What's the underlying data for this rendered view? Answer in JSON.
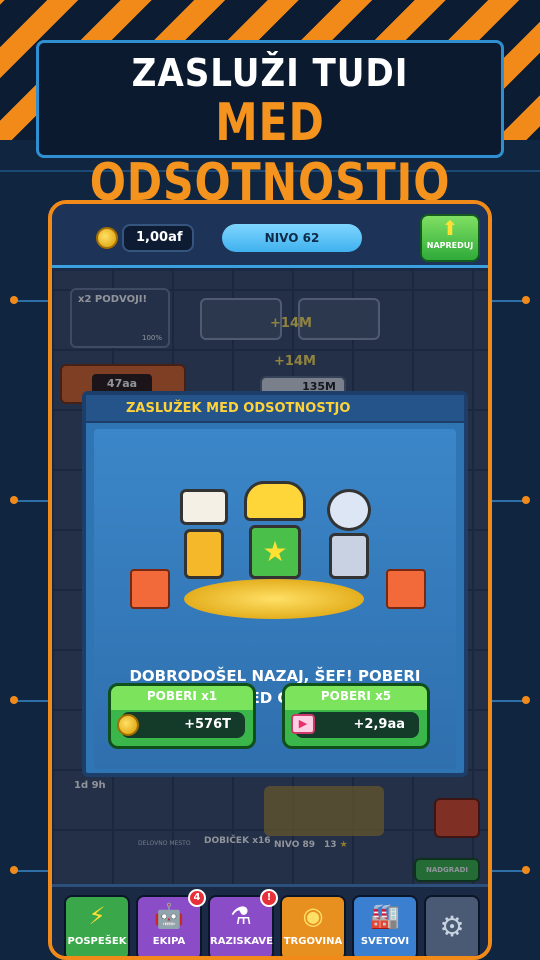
{
  "headline": {
    "line1": "ZASLUŽI TUDI",
    "line2": "MED ODSOTNOSTJO"
  },
  "topbar": {
    "money": "1,00af",
    "level": "NIVO 62",
    "advance_label": "NAPREDUJ"
  },
  "background_ui": {
    "boost_label": "x2 PODVOJI!",
    "boost_pct": "100%",
    "machine_value": "47aa",
    "income_a": "+14M",
    "income_b": "+14M",
    "stock_value": "135M",
    "timer": "1d 9h",
    "workplace_label": "DELOVNO MESTO",
    "profit_label": "DOBIČEK x16",
    "level_info": "NIVO 89",
    "stars": "13",
    "upgrade_label": "NADGRADI"
  },
  "modal": {
    "title": "ZASLUŽEK MED ODSOTNOSTJO",
    "message_line1": "DOBRODOŠEL NAZAJ, ŠEF! POBERI",
    "message_line2": "ZASLUŽEK MED ODSOTNOSTJO!",
    "collect_x1": {
      "label": "POBERI x1",
      "value": "+576T"
    },
    "collect_x5": {
      "label": "POBERI x5",
      "value": "+2,9aa"
    }
  },
  "nav": [
    {
      "label": "POSPEŠEK",
      "icon": "lightning-icon",
      "color": "#3aa84a"
    },
    {
      "label": "EKIPA",
      "icon": "robot-icon",
      "color": "#8a4cc7",
      "badge": "4"
    },
    {
      "label": "RAZISKAVE",
      "icon": "flask-icon",
      "color": "#8a4cc7",
      "badge": "!"
    },
    {
      "label": "TRGOVINA",
      "icon": "coins-icon",
      "color": "#e8901f"
    },
    {
      "label": "SVETOVI",
      "icon": "factory-icon",
      "color": "#3a7fd0"
    },
    {
      "label": "",
      "icon": "gear-icon",
      "color": "#4a5a74"
    }
  ],
  "colors": {
    "accent_orange": "#f28a1a",
    "accent_yellow": "#ffd23a",
    "modal_blue": "#2f74b3",
    "button_green": "#3bb64a"
  }
}
